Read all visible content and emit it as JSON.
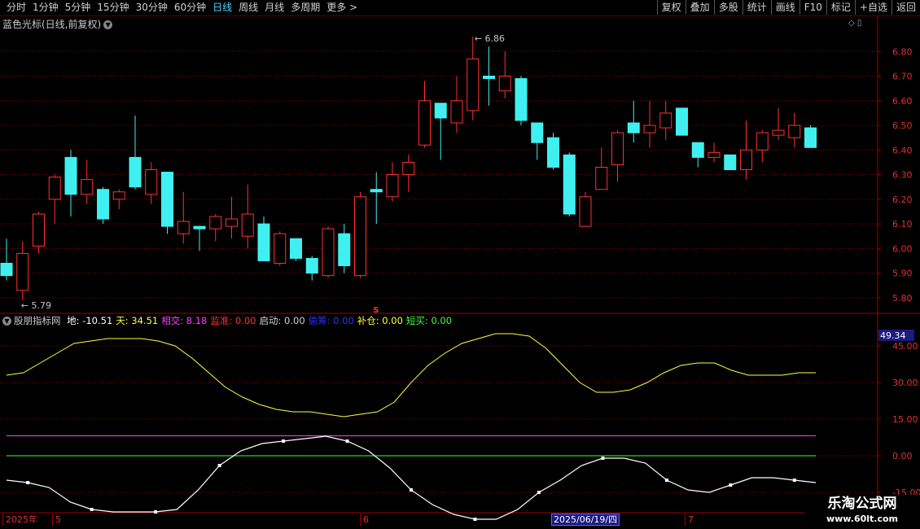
{
  "toolbar": {
    "periods": [
      "分时",
      "1分钟",
      "5分钟",
      "15分钟",
      "30分钟",
      "60分钟",
      "日线",
      "周线",
      "月线",
      "多周期",
      "更多 >"
    ],
    "active_period": "日线",
    "right_buttons": [
      "复权",
      "叠加",
      "多股",
      "统计",
      "画线",
      "F10",
      "标记",
      "+自选",
      "返回"
    ]
  },
  "main_chart": {
    "title": "蓝色光标(日线,前复权)",
    "y_ticks": [
      "6.80",
      "6.70",
      "6.60",
      "6.50",
      "6.40",
      "6.30",
      "6.20",
      "6.10",
      "6.00",
      "5.90",
      "5.80"
    ],
    "high_label": "6.86",
    "low_label": "5.79",
    "signal_mark": "S"
  },
  "indicator": {
    "name": "股朋指标网",
    "fields": [
      {
        "label": "地:",
        "value": "-10.51",
        "color": "#ffffff"
      },
      {
        "label": "天:",
        "value": "34.51",
        "color": "#ffff40"
      },
      {
        "label": "相交:",
        "value": "8.18",
        "color": "#ff40ff"
      },
      {
        "label": "监准:",
        "value": "0.00",
        "color": "#ff3030"
      },
      {
        "label": "启动:",
        "value": "0.00",
        "color": "#d0d0d0"
      },
      {
        "label": "偷筹:",
        "value": "0.00",
        "color": "#3030ff"
      },
      {
        "label": "补仓:",
        "value": "0.00",
        "color": "#ffff40"
      },
      {
        "label": "短买:",
        "value": "0.00",
        "color": "#40ff40"
      }
    ],
    "y_ticks": [
      "45.00",
      "30.00",
      "15.00",
      "0.00",
      "-15.00"
    ],
    "current_value": "49.34"
  },
  "date_axis": {
    "labels": [
      "2025年",
      "5",
      "6",
      "7"
    ],
    "cursor_date": "2025/06/19/四"
  },
  "watermark": {
    "line1": "乐淘公式网",
    "line2": "www.60lt.com"
  },
  "colors": {
    "up": "#ff3030",
    "down": "#40f0f0",
    "grid": "#8a0000",
    "yellow_line": "#ffff40",
    "white_line": "#ffffff",
    "magenta_line": "#ff40ff",
    "green_line": "#40ff40"
  },
  "chart_data": {
    "type": "candlestick",
    "price_range": [
      5.75,
      6.9
    ],
    "candles": [
      {
        "o": 5.94,
        "h": 6.04,
        "l": 5.87,
        "c": 5.89
      },
      {
        "o": 5.83,
        "h": 6.03,
        "l": 5.79,
        "c": 5.98
      },
      {
        "o": 6.01,
        "h": 6.15,
        "l": 5.98,
        "c": 6.14
      },
      {
        "o": 6.2,
        "h": 6.3,
        "l": 6.1,
        "c": 6.29
      },
      {
        "o": 6.37,
        "h": 6.4,
        "l": 6.13,
        "c": 6.22
      },
      {
        "o": 6.22,
        "h": 6.36,
        "l": 6.18,
        "c": 6.28
      },
      {
        "o": 6.24,
        "h": 6.25,
        "l": 6.1,
        "c": 6.12
      },
      {
        "o": 6.2,
        "h": 6.24,
        "l": 6.16,
        "c": 6.23
      },
      {
        "o": 6.37,
        "h": 6.54,
        "l": 6.24,
        "c": 6.25
      },
      {
        "o": 6.22,
        "h": 6.35,
        "l": 6.18,
        "c": 6.32
      },
      {
        "o": 6.31,
        "h": 6.31,
        "l": 6.06,
        "c": 6.09
      },
      {
        "o": 6.06,
        "h": 6.23,
        "l": 6.02,
        "c": 6.11
      },
      {
        "o": 6.09,
        "h": 6.09,
        "l": 5.99,
        "c": 6.08
      },
      {
        "o": 6.08,
        "h": 6.14,
        "l": 6.03,
        "c": 6.13
      },
      {
        "o": 6.09,
        "h": 6.21,
        "l": 6.04,
        "c": 6.12
      },
      {
        "o": 6.05,
        "h": 6.26,
        "l": 6.0,
        "c": 6.14
      },
      {
        "o": 6.1,
        "h": 6.13,
        "l": 5.95,
        "c": 5.95
      },
      {
        "o": 5.94,
        "h": 6.07,
        "l": 5.93,
        "c": 6.06
      },
      {
        "o": 6.04,
        "h": 6.04,
        "l": 5.95,
        "c": 5.96
      },
      {
        "o": 5.96,
        "h": 5.97,
        "l": 5.87,
        "c": 5.9
      },
      {
        "o": 5.89,
        "h": 6.09,
        "l": 5.88,
        "c": 6.08
      },
      {
        "o": 6.06,
        "h": 6.1,
        "l": 5.9,
        "c": 5.93
      },
      {
        "o": 5.89,
        "h": 6.23,
        "l": 5.88,
        "c": 6.21
      },
      {
        "o": 6.24,
        "h": 6.31,
        "l": 6.1,
        "c": 6.23
      },
      {
        "o": 6.21,
        "h": 6.35,
        "l": 6.19,
        "c": 6.3
      },
      {
        "o": 6.3,
        "h": 6.38,
        "l": 6.23,
        "c": 6.35
      },
      {
        "o": 6.42,
        "h": 6.68,
        "l": 6.41,
        "c": 6.6
      },
      {
        "o": 6.59,
        "h": 6.59,
        "l": 6.36,
        "c": 6.53
      },
      {
        "o": 6.51,
        "h": 6.7,
        "l": 6.47,
        "c": 6.6
      },
      {
        "o": 6.56,
        "h": 6.86,
        "l": 6.52,
        "c": 6.77
      },
      {
        "o": 6.7,
        "h": 6.82,
        "l": 6.58,
        "c": 6.69
      },
      {
        "o": 6.64,
        "h": 6.8,
        "l": 6.61,
        "c": 6.7
      },
      {
        "o": 6.69,
        "h": 6.7,
        "l": 6.5,
        "c": 6.52
      },
      {
        "o": 6.51,
        "h": 6.51,
        "l": 6.36,
        "c": 6.43
      },
      {
        "o": 6.45,
        "h": 6.47,
        "l": 6.32,
        "c": 6.33
      },
      {
        "o": 6.38,
        "h": 6.39,
        "l": 6.13,
        "c": 6.14
      },
      {
        "o": 6.09,
        "h": 6.23,
        "l": 6.09,
        "c": 6.21
      },
      {
        "o": 6.24,
        "h": 6.41,
        "l": 6.24,
        "c": 6.33
      },
      {
        "o": 6.34,
        "h": 6.48,
        "l": 6.27,
        "c": 6.47
      },
      {
        "o": 6.51,
        "h": 6.6,
        "l": 6.43,
        "c": 6.47
      },
      {
        "o": 6.47,
        "h": 6.6,
        "l": 6.41,
        "c": 6.5
      },
      {
        "o": 6.49,
        "h": 6.6,
        "l": 6.44,
        "c": 6.55
      },
      {
        "o": 6.57,
        "h": 6.57,
        "l": 6.46,
        "c": 6.46
      },
      {
        "o": 6.43,
        "h": 6.43,
        "l": 6.33,
        "c": 6.37
      },
      {
        "o": 6.37,
        "h": 6.43,
        "l": 6.35,
        "c": 6.39
      },
      {
        "o": 6.38,
        "h": 6.38,
        "l": 6.32,
        "c": 6.32
      },
      {
        "o": 6.32,
        "h": 6.52,
        "l": 6.28,
        "c": 6.4
      },
      {
        "o": 6.4,
        "h": 6.48,
        "l": 6.35,
        "c": 6.47
      },
      {
        "o": 6.46,
        "h": 6.57,
        "l": 6.44,
        "c": 6.48
      },
      {
        "o": 6.45,
        "h": 6.55,
        "l": 6.41,
        "c": 6.5
      },
      {
        "o": 6.49,
        "h": 6.5,
        "l": 6.41,
        "c": 6.41
      }
    ],
    "indicator_range": [
      -22,
      52
    ],
    "tian_line": [
      33,
      34,
      38,
      42,
      46,
      47,
      48,
      48,
      48,
      47,
      45,
      40,
      34,
      28,
      24,
      21,
      19,
      18,
      18,
      17,
      16,
      17,
      18,
      22,
      30,
      37,
      42,
      46,
      48,
      50,
      50,
      49,
      44,
      37,
      30,
      26,
      26,
      27,
      30,
      34,
      37,
      38,
      38,
      35,
      33,
      33,
      33,
      34,
      34
    ],
    "di_line": [
      -10,
      -11,
      -13,
      -19,
      -22,
      -23,
      -23,
      -23,
      -22,
      -14,
      -4,
      2,
      5,
      6,
      7,
      8,
      6,
      2,
      -5,
      -14,
      -20,
      -24,
      -26,
      -26,
      -22,
      -15,
      -10,
      -4,
      -1,
      -1,
      -3,
      -10,
      -14,
      -15,
      -12,
      -9,
      -9,
      -10,
      -11
    ],
    "xiangjiao_level": 8.18,
    "zero_level": 0
  }
}
